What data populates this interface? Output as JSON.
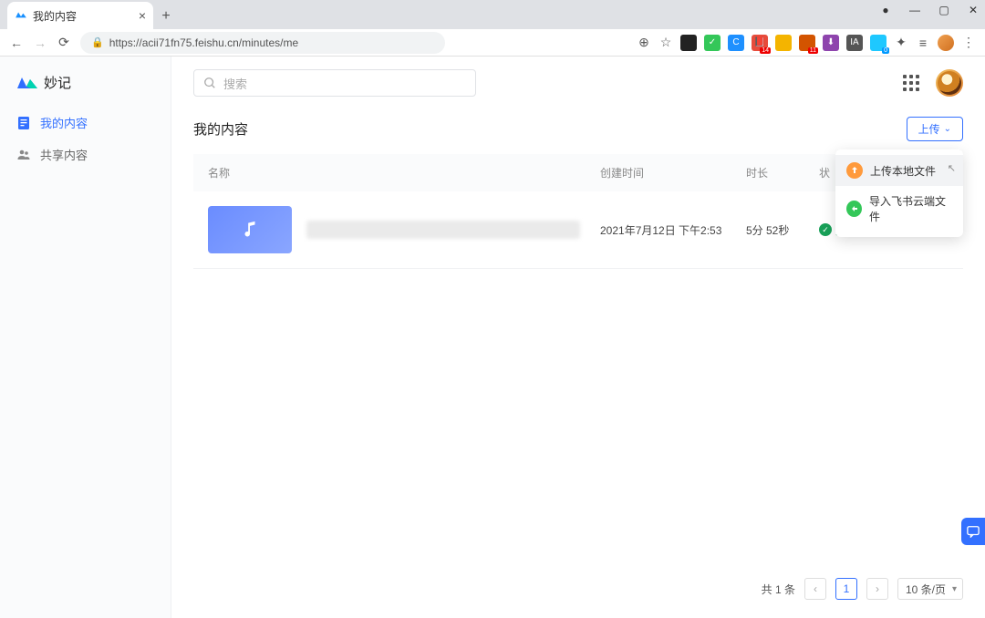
{
  "browser": {
    "tab_title": "我的内容",
    "url": "https://acii71fn75.feishu.cn/minutes/me"
  },
  "app": {
    "logo_text": "妙记",
    "nav": {
      "my_content": "我的内容",
      "shared_content": "共享内容"
    },
    "search_placeholder": "搜索",
    "page_title": "我的内容",
    "upload_label": "上传",
    "dropdown": {
      "upload_local": "上传本地文件",
      "import_cloud": "导入飞书云端文件"
    },
    "table": {
      "col_name": "名称",
      "col_created": "创建时间",
      "col_duration": "时长",
      "col_status": "状",
      "rows": [
        {
          "created": "2021年7月12日 下午2:53",
          "duration": "5分 52秒",
          "status": "完成"
        }
      ]
    },
    "pager": {
      "total": "共 1 条",
      "page": "1",
      "per_page": "10 条/页"
    }
  }
}
